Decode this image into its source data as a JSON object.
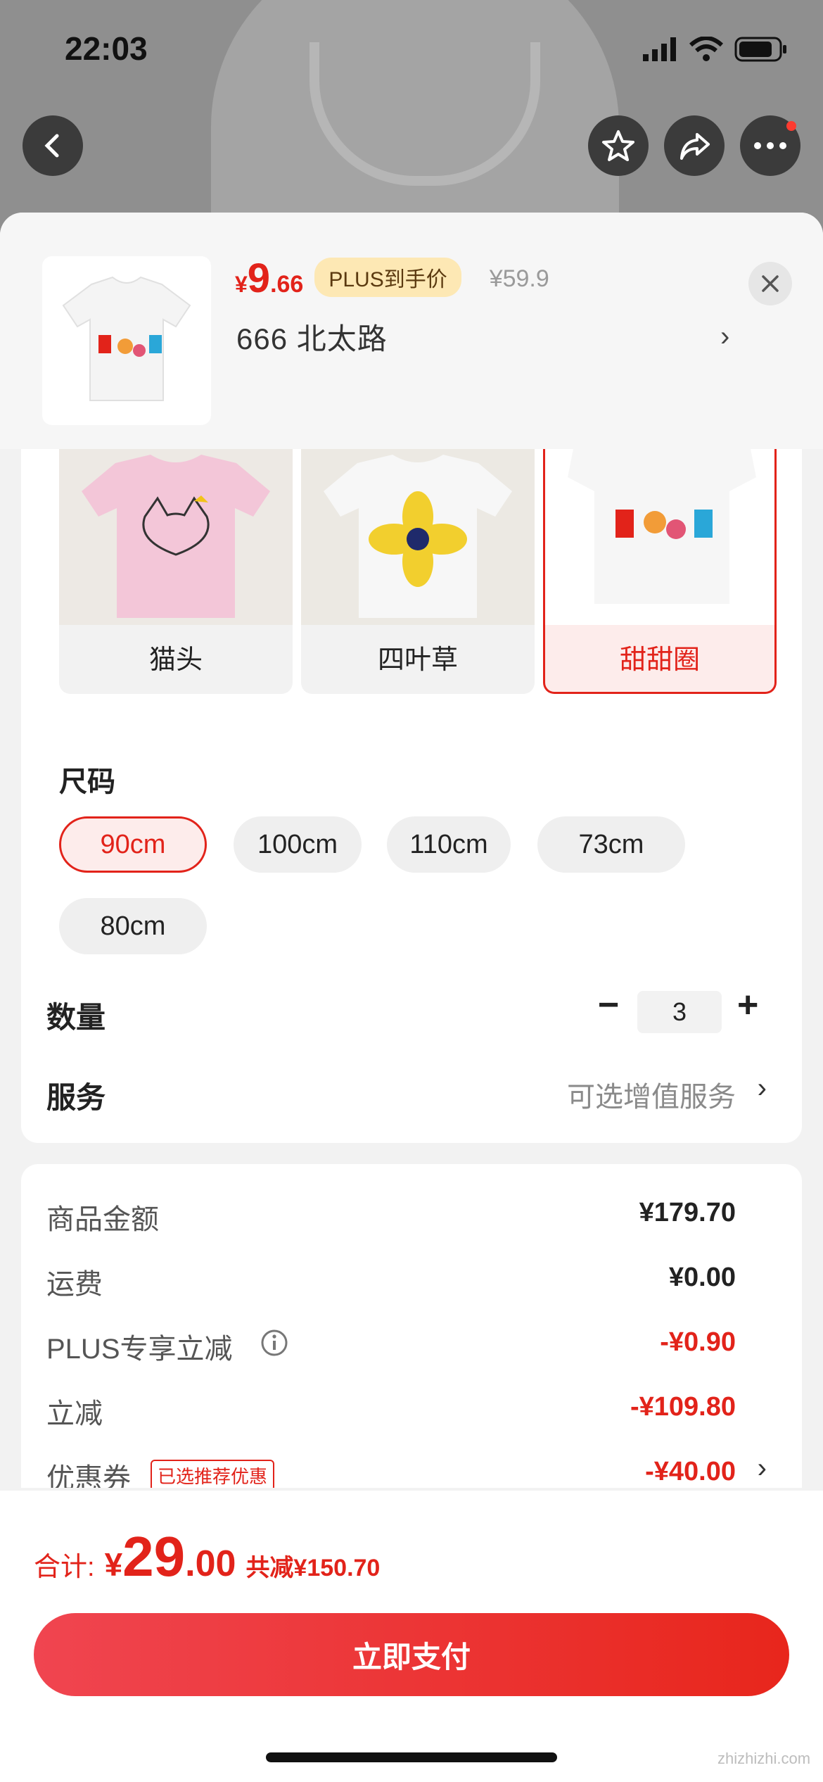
{
  "status_bar": {
    "time": "22:03"
  },
  "top_nav": {
    "back": "back-icon",
    "favorite": "star-icon",
    "share": "share-icon",
    "more": "more-icon"
  },
  "header": {
    "price_symbol": "¥",
    "price_int": "9",
    "price_dec": ".66",
    "plus_tag": "PLUS到手价",
    "original_price": "¥59.9",
    "address": "666  北太路",
    "close": "close-icon"
  },
  "variants": [
    {
      "label": "猫头",
      "selected": false
    },
    {
      "label": "四叶草",
      "selected": false
    },
    {
      "label": "甜甜圈",
      "selected": true
    }
  ],
  "size": {
    "title": "尺码",
    "options": [
      {
        "label": "90cm",
        "selected": true
      },
      {
        "label": "100cm",
        "selected": false
      },
      {
        "label": "110cm",
        "selected": false
      },
      {
        "label": "73cm",
        "selected": false
      },
      {
        "label": "80cm",
        "selected": false
      }
    ]
  },
  "quantity": {
    "title": "数量",
    "minus": "−",
    "value": "3",
    "plus": "+"
  },
  "service": {
    "title": "服务",
    "value": "可选增值服务"
  },
  "fees": [
    {
      "label": "商品金额",
      "value": "¥179.70",
      "red": false
    },
    {
      "label": "运费",
      "value": "¥0.00",
      "red": false
    },
    {
      "label": "PLUS专享立减",
      "value": "-¥0.90",
      "red": true
    },
    {
      "label": "立减",
      "value": "-¥109.80",
      "red": true
    },
    {
      "label": "优惠券",
      "value": "-¥40.00",
      "red": true
    }
  ],
  "coupon_badge": "已选推荐优惠",
  "total": {
    "label": "合计:",
    "yen": "¥",
    "int": "29",
    "dec": ".00",
    "saved": "共减¥150.70"
  },
  "pay_button": "立即支付",
  "watermark": "zhizhizhi.com",
  "colors": {
    "accent": "#e2231a",
    "plus_tag_bg": "#fde8b4"
  }
}
